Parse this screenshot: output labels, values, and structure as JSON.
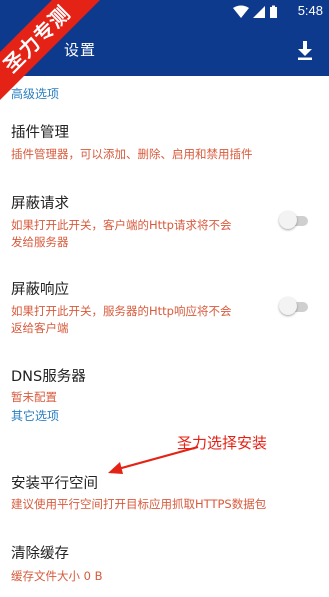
{
  "statusbar": {
    "time": "5:48"
  },
  "watermark": {
    "text": "圣力专测"
  },
  "appbar": {
    "title": "设置",
    "download_icon": "download-icon"
  },
  "sections": {
    "advanced": {
      "header": "高级选项"
    },
    "other": {
      "header": "其它选项"
    }
  },
  "items": {
    "plugin": {
      "title": "插件管理",
      "subtitle": "插件管理器，可以添加、删除、启用和禁用插件"
    },
    "block_request": {
      "title": "屏蔽请求",
      "subtitle_line1": "如果打开此开关，客户端的Http请求将不会",
      "subtitle_line2": "发给服务器",
      "enabled": false
    },
    "block_response": {
      "title": "屏蔽响应",
      "subtitle_line1": "如果打开此开关，服务器的Http响应将不会",
      "subtitle_line2": "返给客户端",
      "enabled": false
    },
    "dns": {
      "title": "DNS服务器",
      "subtitle": "暂未配置"
    },
    "parallel_space": {
      "title": "安装平行空间",
      "subtitle": "建议使用平行空间打开目标应用抓取HTTPS数据包"
    },
    "clear_cache": {
      "title": "清除缓存",
      "subtitle": "缓存文件大小 0 B"
    }
  },
  "annotation": {
    "text": "圣力选择安装"
  },
  "colors": {
    "appbar": "#0d3a8c",
    "section_header": "#2a7fc2",
    "subtitle": "#d85a3c",
    "annotation": "#e52216"
  }
}
